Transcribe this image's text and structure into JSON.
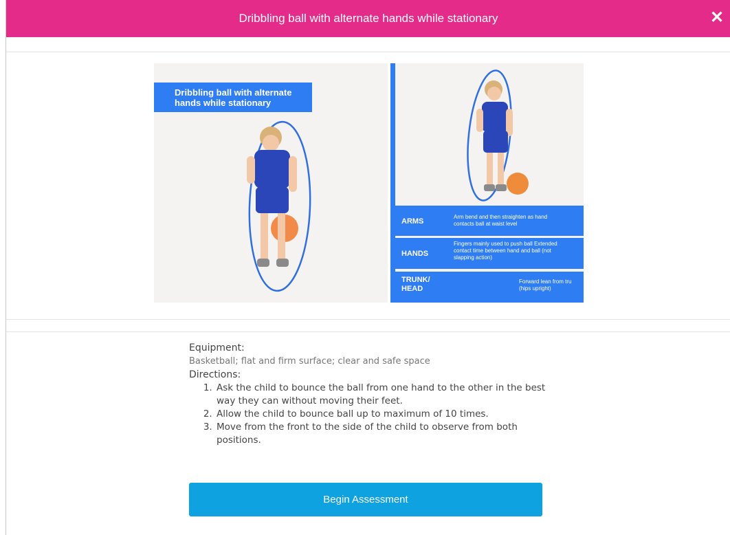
{
  "header": {
    "title": "Dribbling ball with alternate hands while stationary",
    "close_label": "✕"
  },
  "media": {
    "left_caption": "Dribbling ball with alternate hands while stationary",
    "cues": [
      {
        "label": "ARMS",
        "text": "Arm bend and then straighten as hand contacts ball at waist level"
      },
      {
        "label": "HANDS",
        "text": "Fingers mainly used to push ball Extended contact time between hand and ball (not slapping action)"
      },
      {
        "label": "TRUNK/ HEAD",
        "text": "Forward lean from tru (hips upright)"
      }
    ]
  },
  "details": {
    "equipment_title": "Equipment:",
    "equipment_text": "Basketball; flat and firm surface; clear and safe space",
    "directions_title": "Directions:",
    "directions": [
      "Ask the child to bounce the ball from one hand to the other in the best way they can without moving their feet.",
      "Allow the child to bounce ball up to maximum of 10 times.",
      "Move from the front to the side of the child to observe from both positions."
    ]
  },
  "actions": {
    "begin_label": "Begin Assessment"
  },
  "colors": {
    "header": "#e52b89",
    "accent_blue": "#2f7df2",
    "button": "#0ea2e0"
  }
}
